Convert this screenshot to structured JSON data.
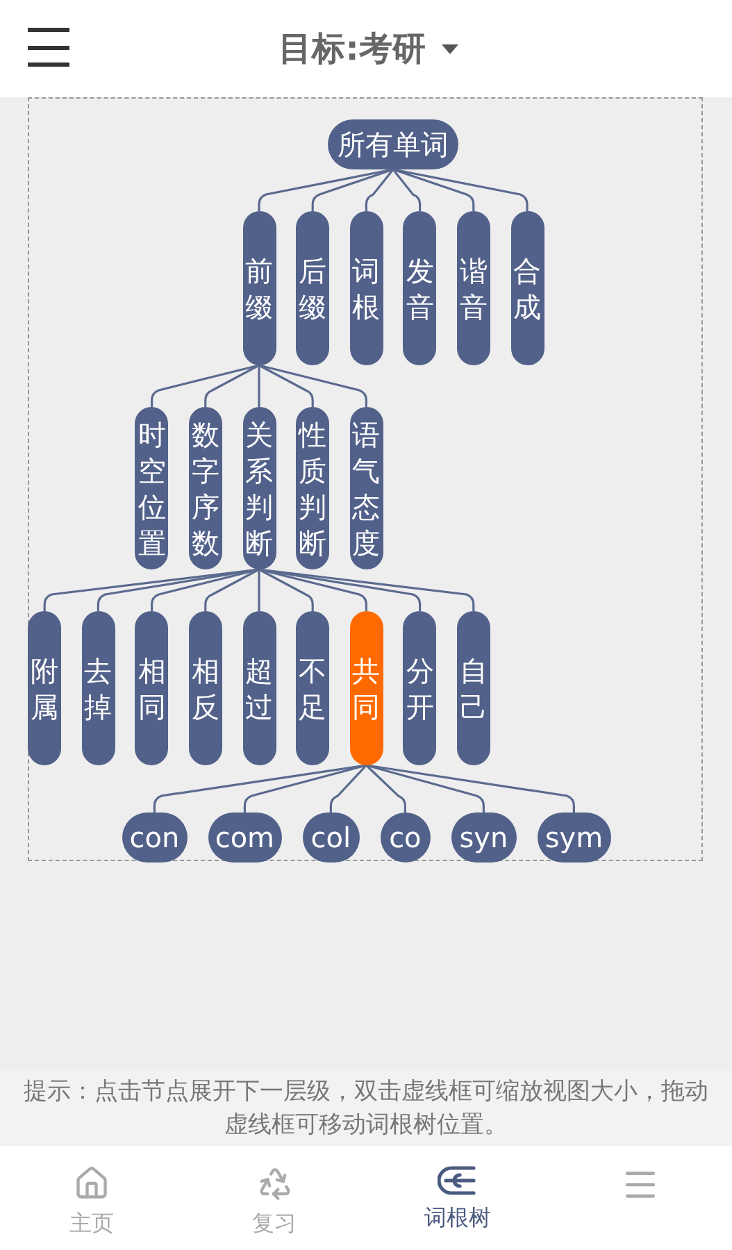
{
  "header": {
    "title": "目标:考研"
  },
  "tree": {
    "label": "所有单词",
    "kind": "pill",
    "selected": false,
    "children": [
      {
        "label": "前缀",
        "kind": "column",
        "selected": false,
        "children": [
          {
            "label": "时空位置",
            "kind": "column",
            "selected": false
          },
          {
            "label": "数字序数",
            "kind": "column",
            "selected": false
          },
          {
            "label": "关系判断",
            "kind": "column",
            "selected": false,
            "children": [
              {
                "label": "附属",
                "kind": "column",
                "selected": false
              },
              {
                "label": "去掉",
                "kind": "column",
                "selected": false
              },
              {
                "label": "相同",
                "kind": "column",
                "selected": false
              },
              {
                "label": "相反",
                "kind": "column",
                "selected": false
              },
              {
                "label": "超过",
                "kind": "column",
                "selected": false
              },
              {
                "label": "不足",
                "kind": "column",
                "selected": false
              },
              {
                "label": "共同",
                "kind": "column",
                "selected": true,
                "children": [
                  {
                    "label": "con",
                    "kind": "pill",
                    "selected": false
                  },
                  {
                    "label": "com",
                    "kind": "pill",
                    "selected": false
                  },
                  {
                    "label": "col",
                    "kind": "pill",
                    "selected": false
                  },
                  {
                    "label": "co",
                    "kind": "pill",
                    "selected": false
                  },
                  {
                    "label": "syn",
                    "kind": "pill",
                    "selected": false
                  },
                  {
                    "label": "sym",
                    "kind": "pill",
                    "selected": false
                  }
                ]
              },
              {
                "label": "分开",
                "kind": "column",
                "selected": false
              },
              {
                "label": "自己",
                "kind": "column",
                "selected": false
              }
            ]
          },
          {
            "label": "性质判断",
            "kind": "column",
            "selected": false
          },
          {
            "label": "语气态度",
            "kind": "column",
            "selected": false
          }
        ]
      },
      {
        "label": "后缀",
        "kind": "column",
        "selected": false
      },
      {
        "label": "词根",
        "kind": "column",
        "selected": false
      },
      {
        "label": "发音",
        "kind": "column",
        "selected": false
      },
      {
        "label": "谐音",
        "kind": "column",
        "selected": false
      },
      {
        "label": "合成",
        "kind": "column",
        "selected": false
      }
    ]
  },
  "hint": "提示：点击节点展开下一层级，双击虚线框可缩放视图大小，拖动虚线框可移动词根树位置。",
  "nav": [
    {
      "label": "主页",
      "selected": false
    },
    {
      "label": "复习",
      "selected": false
    },
    {
      "label": "词根树",
      "selected": true
    },
    {
      "selected": false
    }
  ]
}
